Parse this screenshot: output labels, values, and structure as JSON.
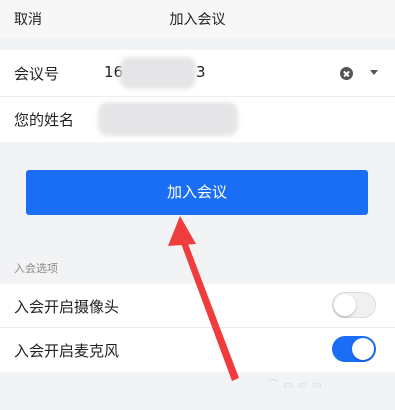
{
  "header": {
    "cancel_label": "取消",
    "title": "加入会议"
  },
  "form": {
    "meeting_id": {
      "label": "会议号",
      "value_start": "16",
      "value_end": "3"
    },
    "name": {
      "label": "您的姓名"
    }
  },
  "join_button_label": "加入会议",
  "options": {
    "section_label": "入会选项",
    "items": [
      {
        "label": "入会开启摄像头",
        "enabled": false
      },
      {
        "label": "入会开启麦克风",
        "enabled": true
      }
    ]
  },
  "icons": {
    "clear": "clear-circle-x-icon",
    "dropdown": "caret-down-icon",
    "annotation": "red-arrow-icon"
  },
  "colors": {
    "accent": "#1a6ef5",
    "annotation": "#f03c3c"
  }
}
